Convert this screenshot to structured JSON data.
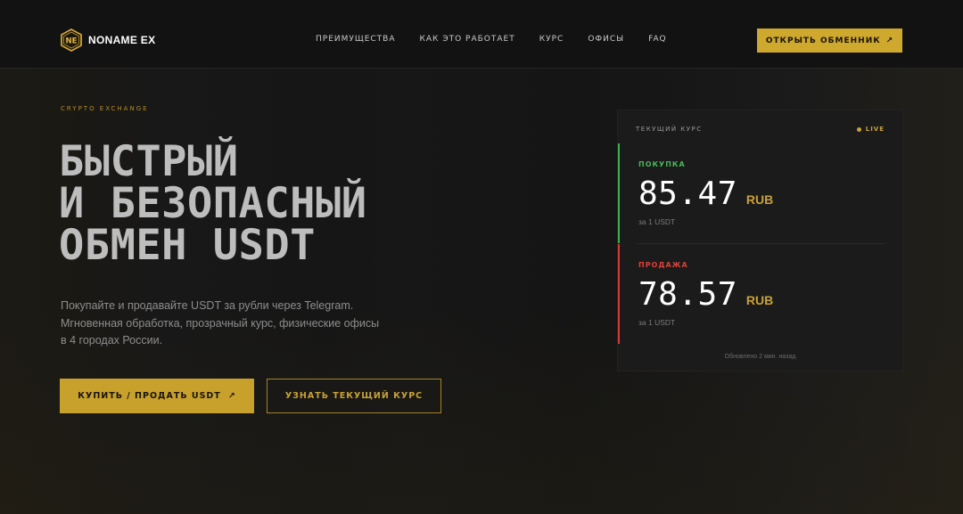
{
  "header": {
    "logo_mark_text": "NE",
    "logo_text": "NONAME EX",
    "nav": [
      {
        "label": "ПРЕИМУЩЕСТВА"
      },
      {
        "label": "КАК ЭТО РАБОТАЕТ"
      },
      {
        "label": "КУРС"
      },
      {
        "label": "ОФИСЫ"
      },
      {
        "label": "FAQ"
      }
    ],
    "cta_label": "ОТКРЫТЬ ОБМЕННИК",
    "cta_arrow": "↗"
  },
  "hero": {
    "eyebrow": "CRYPTO EXCHANGE",
    "title_lines": [
      "БЫСТРЫЙ",
      "И БЕЗОПАСНЫЙ",
      "ОБМЕН USDT"
    ],
    "description_lines": [
      "Покупайте и продавайте USDT за рубли через Telegram.",
      "Мгновенная обработка, прозрачный курс, физические офисы",
      "в 4 городах России."
    ],
    "primary_button": "КУПИТЬ / ПРОДАТЬ USDT",
    "primary_arrow": "↗",
    "secondary_button": "УЗНАТЬ ТЕКУЩИЙ КУРС"
  },
  "rate_card": {
    "title": "ТЕКУЩИЙ КУРС",
    "live": "LIVE",
    "buy": {
      "label": "ПОКУПКА",
      "value": "85.47",
      "currency": "RUB",
      "unit": "за 1 USDT"
    },
    "sell": {
      "label": "ПРОДАЖА",
      "value": "78.57",
      "currency": "RUB",
      "unit": "за 1 USDT"
    },
    "updated": "Обновлено 2 мин. назад"
  },
  "colors": {
    "accent": "#cfa92e",
    "buy": "#3db04e",
    "sell": "#d83a32",
    "background": "#151515"
  },
  "icons": [
    "logo-hexagon-icon",
    "arrow-up-right-icon",
    "live-dot-icon"
  ]
}
